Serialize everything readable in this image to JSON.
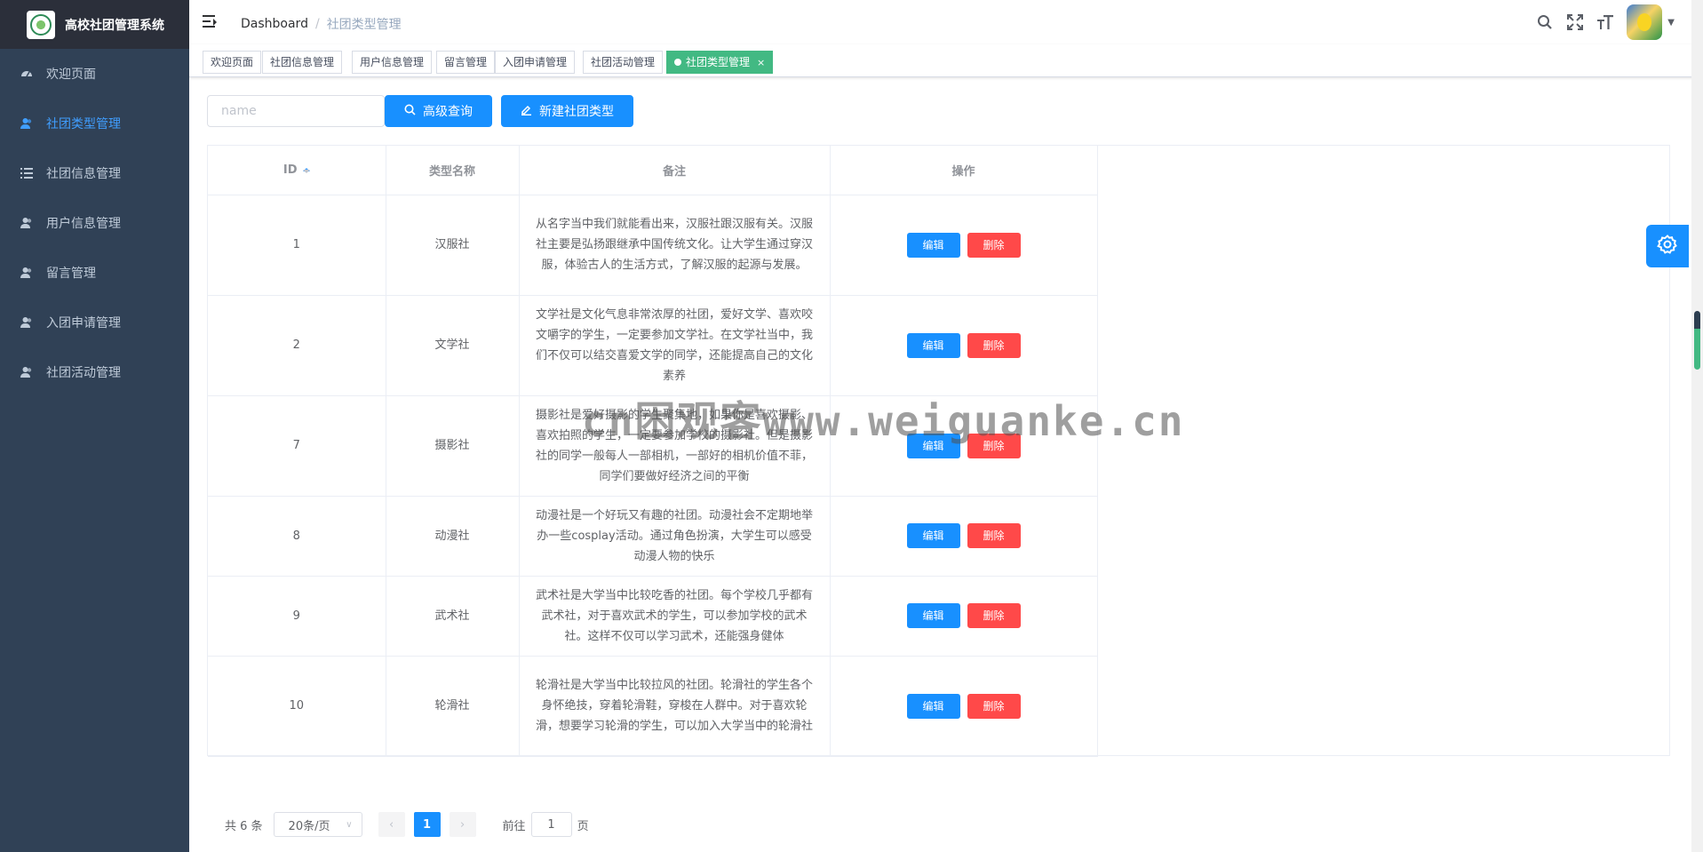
{
  "app": {
    "title": "高校社团管理系统"
  },
  "sidebar": {
    "items": [
      {
        "label": "欢迎页面",
        "icon": "dashboard-icon",
        "active": false
      },
      {
        "label": "社团类型管理",
        "icon": "user-icon",
        "active": true
      },
      {
        "label": "社团信息管理",
        "icon": "list-icon",
        "active": false
      },
      {
        "label": "用户信息管理",
        "icon": "user-icon",
        "active": false
      },
      {
        "label": "留言管理",
        "icon": "user-icon",
        "active": false
      },
      {
        "label": "入团申请管理",
        "icon": "user-icon",
        "active": false
      },
      {
        "label": "社团活动管理",
        "icon": "user-icon",
        "active": false
      }
    ]
  },
  "header": {
    "breadcrumb_home": "Dashboard",
    "breadcrumb_separator": "/",
    "breadcrumb_current": "社团类型管理"
  },
  "tags": [
    {
      "label": "欢迎页面",
      "active": false
    },
    {
      "label": "社团信息管理",
      "active": false
    },
    {
      "label": "用户信息管理",
      "active": false
    },
    {
      "label": "留言管理",
      "active": false
    },
    {
      "label": "入团申请管理",
      "active": false
    },
    {
      "label": "社团活动管理",
      "active": false
    },
    {
      "label": "社团类型管理",
      "active": true,
      "close": "×"
    }
  ],
  "toolbar": {
    "search_placeholder": "name",
    "search_value": "",
    "search_label": "高级查询",
    "create_label": "新建社团类型"
  },
  "table": {
    "headers": [
      "ID",
      "类型名称",
      "备注",
      "操作"
    ],
    "edit_label": "编辑",
    "delete_label": "删除",
    "rows": [
      {
        "id": "1",
        "name": "汉服社",
        "note": "从名字当中我们就能看出来，汉服社跟汉服有关。汉服社主要是弘扬跟继承中国传统文化。让大学生通过穿汉服，体验古人的生活方式，了解汉服的起源与发展。"
      },
      {
        "id": "2",
        "name": "文学社",
        "note": "文学社是文化气息非常浓厚的社团，爱好文学、喜欢咬文嚼字的学生，一定要参加文学社。在文学社当中，我们不仅可以结交喜爱文学的同学，还能提高自己的文化素养"
      },
      {
        "id": "7",
        "name": "摄影社",
        "note": "摄影社是爱好摄影的学生聚集地，如果你是喜欢摄影、喜欢拍照的学生，一定要参加学校的摄影社。但是摄影社的同学一般每人一部相机，一部好的相机价值不菲，同学们要做好经济之间的平衡"
      },
      {
        "id": "8",
        "name": "动漫社",
        "note": "动漫社是一个好玩又有趣的社团。动漫社会不定期地举办一些cosplay活动。通过角色扮演，大学生可以感受动漫人物的快乐"
      },
      {
        "id": "9",
        "name": "武术社",
        "note": "武术社是大学当中比较吃香的社团。每个学校几乎都有武术社，对于喜欢武术的学生，可以参加学校的武术社。这样不仅可以学习武术，还能强身健体"
      },
      {
        "id": "10",
        "name": "轮滑社",
        "note": "轮滑社是大学当中比较拉风的社团。轮滑社的学生各个身怀绝技，穿着轮滑鞋，穿梭在人群中。对于喜欢轮滑，想要学习轮滑的学生，可以加入大学当中的轮滑社"
      }
    ]
  },
  "pagination": {
    "total_text": "共 6 条",
    "page_size": "20条/页",
    "current_page": "1",
    "goto_prefix": "前往",
    "goto_value": "1",
    "goto_suffix": "页"
  },
  "watermark": "cn困观客www.weiguanke.cn",
  "colors": {
    "sidebar_bg": "#304156",
    "logo_bg": "#2b2f3a",
    "primary": "#1890ff",
    "danger": "#ff4949",
    "tag_active": "#42b983"
  }
}
